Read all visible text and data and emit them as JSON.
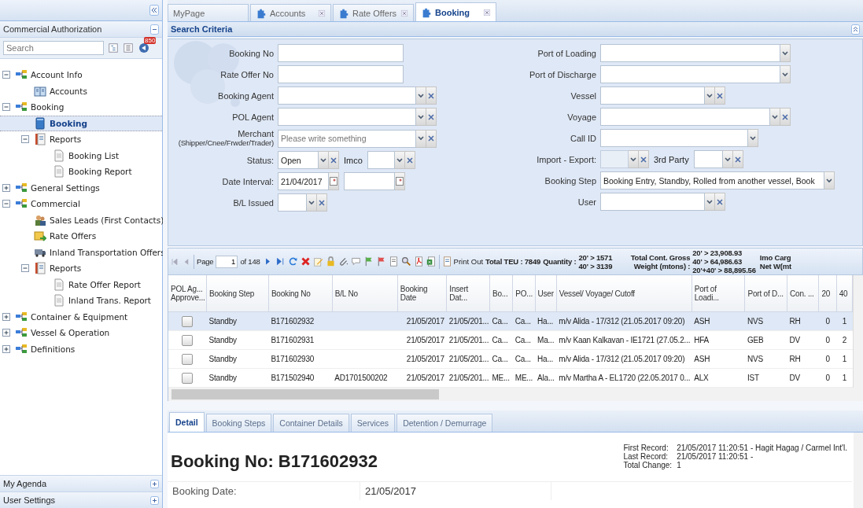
{
  "sidebar": {
    "panel_title": "Commercial Authorization",
    "search": {
      "placeholder": "Search"
    },
    "badge": "850",
    "tree": [
      {
        "label": "Account Info",
        "kind": "group",
        "expanded": true,
        "selected": false,
        "children": [
          {
            "label": "Accounts",
            "kind": "accounts",
            "selected": false
          }
        ]
      },
      {
        "label": "Booking",
        "kind": "group",
        "expanded": true,
        "selected": false,
        "children": [
          {
            "label": "Booking",
            "kind": "booking",
            "selected": true
          },
          {
            "label": "Reports",
            "kind": "reports",
            "expanded": true,
            "selected": false,
            "children": [
              {
                "label": "Booking List",
                "kind": "doc",
                "selected": false
              },
              {
                "label": "Booking Report",
                "kind": "doc",
                "selected": false
              }
            ]
          }
        ]
      },
      {
        "label": "General Settings",
        "kind": "group",
        "expanded": false,
        "selected": false
      },
      {
        "label": "Commercial",
        "kind": "group",
        "expanded": true,
        "selected": false,
        "children": [
          {
            "label": "Sales Leads (First Contacts)",
            "kind": "leads",
            "selected": false
          },
          {
            "label": "Rate Offers",
            "kind": "offers",
            "selected": false
          },
          {
            "label": "Inland Transportation Offers",
            "kind": "truck",
            "selected": false
          },
          {
            "label": "Reports",
            "kind": "reports",
            "expanded": true,
            "selected": false,
            "children": [
              {
                "label": "Rate Offer Report",
                "kind": "doc",
                "selected": false
              },
              {
                "label": "Inland Trans. Report",
                "kind": "doc",
                "selected": false
              }
            ]
          }
        ]
      },
      {
        "label": "Container & Equipment",
        "kind": "group",
        "expanded": false,
        "selected": false
      },
      {
        "label": "Vessel & Operation",
        "kind": "group",
        "expanded": false,
        "selected": false
      },
      {
        "label": "Definitions",
        "kind": "group",
        "expanded": false,
        "selected": false
      }
    ],
    "bottom_panels": [
      {
        "title": "My Agenda"
      },
      {
        "title": "User Settings"
      }
    ]
  },
  "tabs": [
    {
      "label": "MyPage",
      "kind": "page",
      "closable": false,
      "selected": false
    },
    {
      "label": "Accounts",
      "kind": "module",
      "closable": true,
      "selected": false
    },
    {
      "label": "Rate Offers",
      "kind": "module",
      "closable": true,
      "selected": false
    },
    {
      "label": "Booking",
      "kind": "module",
      "closable": true,
      "selected": true
    }
  ],
  "search_criteria": {
    "title": "Search Criteria",
    "left_fields": [
      {
        "label": "Booking No",
        "controls": [
          {
            "kind": "text",
            "disabled": false
          }
        ]
      },
      {
        "label": "Rate Offer No",
        "controls": [
          {
            "kind": "text",
            "disabled": false
          }
        ]
      },
      {
        "label": "Booking Agent",
        "controls": [
          {
            "kind": "combo_clear",
            "disabled": false
          }
        ]
      },
      {
        "label": "POL Agent",
        "controls": [
          {
            "kind": "combo_clear",
            "disabled": false
          }
        ]
      },
      {
        "label": "Merchant",
        "sublabel": "(Shipper/Cnee/Frwder/Trader)",
        "controls": [
          {
            "kind": "combo_clear",
            "placeholder": "Please write something",
            "disabled": false
          }
        ]
      },
      {
        "label": "Status:",
        "controls": [
          {
            "kind": "combo_clear",
            "value": "Open",
            "disabled": false
          },
          {
            "kind": "combo_clear",
            "label": "Imco",
            "disabled": false
          }
        ]
      },
      {
        "label": "Date Interval:",
        "controls": [
          {
            "kind": "date",
            "value": "21/04/2017",
            "disabled": false
          },
          {
            "kind": "date",
            "disabled": false
          }
        ]
      },
      {
        "label": "B/L Issued",
        "controls": [
          {
            "kind": "combo_clear",
            "disabled": false
          }
        ]
      }
    ],
    "right_fields": [
      {
        "label": "Port of Loading",
        "controls": [
          {
            "kind": "combo",
            "disabled": false
          }
        ]
      },
      {
        "label": "Port of Discharge",
        "controls": [
          {
            "kind": "combo",
            "disabled": false
          }
        ]
      },
      {
        "label": "Vessel",
        "controls": [
          {
            "kind": "combo_clear",
            "disabled": false
          }
        ]
      },
      {
        "label": "Voyage",
        "controls": [
          {
            "kind": "combo_clear",
            "disabled": false
          }
        ]
      },
      {
        "label": "Call ID",
        "controls": [
          {
            "kind": "combo",
            "disabled": false
          }
        ]
      },
      {
        "label": "Import - Export:",
        "controls": [
          {
            "kind": "combo_clear",
            "disabled": true
          },
          {
            "kind": "combo_clear",
            "label": "3rd Party",
            "disabled": false
          }
        ]
      },
      {
        "label": "Booking Step",
        "controls": [
          {
            "kind": "combo",
            "value": "Booking Entry, Standby, Rolled from another vessel, Book",
            "disabled": false
          }
        ]
      },
      {
        "label": "User",
        "controls": [
          {
            "kind": "combo_clear",
            "disabled": false
          }
        ]
      }
    ]
  },
  "toolbar": {
    "page_label": "Page",
    "page": "1",
    "page_count": "of 148",
    "print": "Print Out",
    "total_teu": "Total TEU : 7849",
    "quantity_label": "Quantity :",
    "quantity": [
      "20' > 1571",
      "40' > 3139"
    ],
    "weight_label": "Total Cont. Gross Weight (mtons) :",
    "weight": [
      "20' > 23,908.93",
      "40' > 64,986.63",
      "20'+40' > 88,895.56"
    ],
    "imo": [
      "Imo Carg",
      "Net W(mt"
    ]
  },
  "table": {
    "columns": [
      "POL Ag... Approve...",
      "Booking Step",
      "Booking No",
      "B/L No",
      "Booking Date",
      "Insert Dat...",
      "Bo...",
      "PO...",
      "User",
      "Vessel/ Voyage/ Cutoff",
      "Port of Loadi...",
      "Port of D...",
      "Con. ...",
      "20",
      "40"
    ],
    "rows": [
      {
        "selected": true,
        "checked": false,
        "cells": [
          "",
          "Standby",
          "B171602932",
          "",
          "21/05/2017",
          "21/05/201...",
          "Ca...",
          "Ca...",
          "Ha...",
          "m/v Alida - 17/312 (21.05.2017 09:20)",
          "ASH",
          "NVS",
          "RH",
          "0",
          "1"
        ]
      },
      {
        "selected": false,
        "checked": false,
        "cells": [
          "",
          "Standby",
          "B171602931",
          "",
          "21/05/2017",
          "21/05/201...",
          "Ca...",
          "Ca...",
          "Ma...",
          "m/v Kaan Kalkavan - IE1721 (27.05.2...",
          "HFA",
          "GEB",
          "DV",
          "0",
          "2"
        ]
      },
      {
        "selected": false,
        "checked": false,
        "cells": [
          "",
          "Standby",
          "B171602930",
          "",
          "21/05/2017",
          "21/05/201...",
          "Ca...",
          "Ca...",
          "Ha...",
          "m/v Alida - 17/312 (21.05.2017 09:20)",
          "ASH",
          "NVS",
          "RH",
          "0",
          "1"
        ]
      },
      {
        "selected": false,
        "checked": false,
        "cells": [
          "",
          "Standby",
          "B171502940",
          "AD1701500202",
          "21/05/2017",
          "21/05/201...",
          "ME...",
          "ME...",
          "Ala...",
          "m/v Martha A - EL1720 (22.05.2017 0...",
          "ALX",
          "IST",
          "DV",
          "0",
          "1"
        ]
      }
    ]
  },
  "detail_tabs": [
    {
      "label": "Detail",
      "selected": true
    },
    {
      "label": "Booking Steps",
      "selected": false
    },
    {
      "label": "Container Details",
      "selected": false
    },
    {
      "label": "Services",
      "selected": false
    },
    {
      "label": "Detention / Demurrage",
      "selected": false
    }
  ],
  "detail": {
    "title": "Booking No: B171602932",
    "records": [
      {
        "label": "First Record:",
        "value": "21/05/2017 11:20:51 - Hagit Hagag / Carmel Int'l."
      },
      {
        "label": "Last Record:",
        "value": "21/05/2017 11:20:51 -"
      },
      {
        "label": "Total Change:",
        "value": "1"
      }
    ],
    "fields": [
      {
        "label": "Booking Date:",
        "value": "21/05/2017"
      }
    ]
  }
}
